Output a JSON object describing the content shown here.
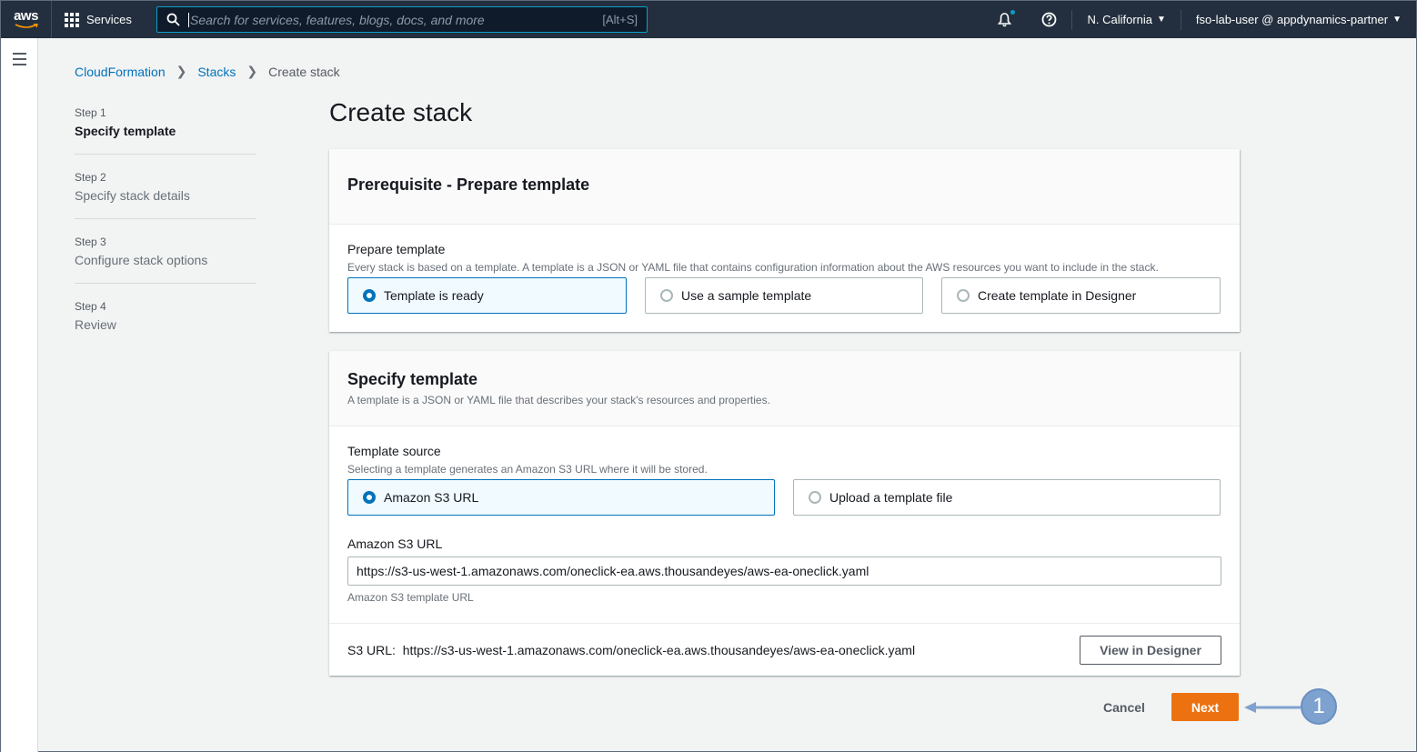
{
  "nav": {
    "logo": "aws",
    "services": "Services",
    "search_placeholder": "Search for services, features, blogs, docs, and more",
    "search_shortcut": "[Alt+S]",
    "region": "N. California",
    "account": "fso-lab-user @ appdynamics-partner"
  },
  "breadcrumb": [
    "CloudFormation",
    "Stacks",
    "Create stack"
  ],
  "steps": [
    {
      "num": "Step 1",
      "name": "Specify template"
    },
    {
      "num": "Step 2",
      "name": "Specify stack details"
    },
    {
      "num": "Step 3",
      "name": "Configure stack options"
    },
    {
      "num": "Step 4",
      "name": "Review"
    }
  ],
  "page_title": "Create stack",
  "prereq": {
    "heading": "Prerequisite - Prepare template",
    "label": "Prepare template",
    "description": "Every stack is based on a template. A template is a JSON or YAML file that contains configuration information about the AWS resources you want to include in the stack.",
    "options": [
      "Template is ready",
      "Use a sample template",
      "Create template in Designer"
    ]
  },
  "specify": {
    "heading": "Specify template",
    "subheading": "A template is a JSON or YAML file that describes your stack's resources and properties.",
    "source_label": "Template source",
    "source_desc": "Selecting a template generates an Amazon S3 URL where it will be stored.",
    "options": [
      "Amazon S3 URL",
      "Upload a template file"
    ],
    "url_label": "Amazon S3 URL",
    "url_value": "https://s3-us-west-1.amazonaws.com/oneclick-ea.aws.thousandeyes/aws-ea-oneclick.yaml",
    "url_hint": "Amazon S3 template URL",
    "s3_label": "S3 URL:",
    "s3_value": "https://s3-us-west-1.amazonaws.com/oneclick-ea.aws.thousandeyes/aws-ea-oneclick.yaml",
    "designer_button": "View in Designer"
  },
  "actions": {
    "cancel": "Cancel",
    "next": "Next"
  },
  "callout": "1"
}
